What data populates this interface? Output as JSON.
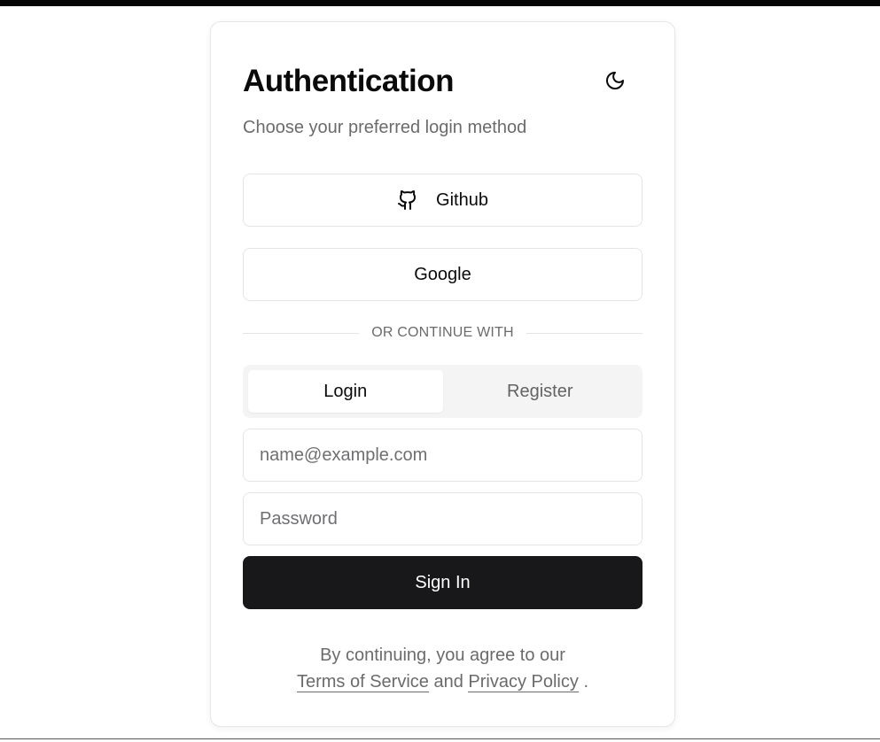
{
  "auth": {
    "title": "Authentication",
    "subtitle": "Choose your preferred login method",
    "theme_toggle_icon": "moon-icon"
  },
  "oauth": {
    "github_label": "Github",
    "github_icon": "github-icon",
    "google_label": "Google"
  },
  "divider_text": "OR CONTINUE WITH",
  "tabs": [
    {
      "label": "Login",
      "active": true
    },
    {
      "label": "Register",
      "active": false
    }
  ],
  "form": {
    "email_placeholder": "name@example.com",
    "email_value": "",
    "password_placeholder": "Password",
    "password_value": "",
    "submit_label": "Sign In"
  },
  "footer": {
    "prefix": "By continuing, you agree to our",
    "terms_link": "Terms of Service",
    "conjunction": "and",
    "privacy_link": "Privacy Policy",
    "suffix": "."
  },
  "colors": {
    "primary_button": "#18181b",
    "muted_text": "#6b6b6b",
    "border": "#e4e4e7",
    "tab_background": "#f4f4f5"
  }
}
